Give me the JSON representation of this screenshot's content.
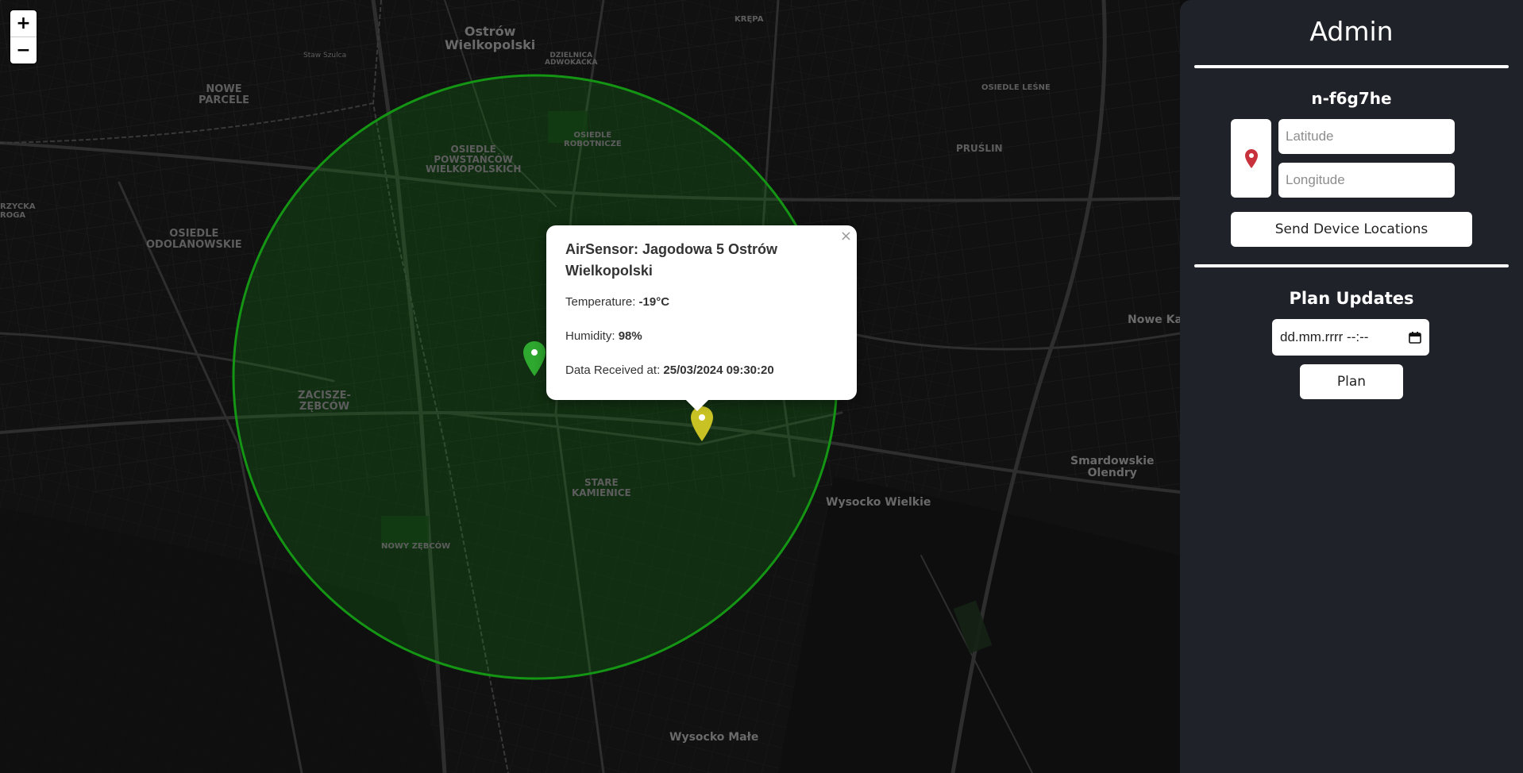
{
  "map": {
    "zoom_in_label": "+",
    "zoom_out_label": "−",
    "labels": {
      "ostrow": "Ostrów\nWielkopolski",
      "krepa": "KRĘPA",
      "stawszulca": "Staw Szulca",
      "dzielnica": "DZIELNICA\nADWOKACKA",
      "nowe_parcele": "NOWE\nPARCELE",
      "osiedle_lesne": "OSIEDLE LEŚNE",
      "robotnicze": "OSIEDLE\nROBOTNICZE",
      "powstancow": "OSIEDLE\nPOWSTAŃCÓW\nWIELKOPOLSKICH",
      "pruslin": "PRUŚLIN",
      "krzycka": "RZYCKA\nROGA",
      "odolanowskie": "OSIEDLE\nODOLANOWSKIE",
      "nowe_ka": "Nowe Ka",
      "zacisze": "ZACISZE-\nZĘBCÓW",
      "smardowskie": "Smardowskie\nOlendry",
      "stare_kamienice": "STARE\nKAMIENICE",
      "wysocko_wielkie": "Wysocko Wielkie",
      "nowy_zebcow": "NOWY ZĘBCÓW",
      "wysocko_male": "Wysocko Małe"
    },
    "circle_color": "#149514",
    "markers": [
      {
        "name": "green-sensor-marker",
        "color": "#2ea82e"
      },
      {
        "name": "yellow-sensor-marker",
        "color": "#c9c225"
      }
    ]
  },
  "popup": {
    "close_label": "×",
    "title": "AirSensor: Jagodowa 5 Ostrów Wielkopolski",
    "temperature_label": "Temperature:",
    "temperature_value": "-19°C",
    "humidity_label": "Humidity:",
    "humidity_value": "98%",
    "received_label": "Data Received at:",
    "received_value": "25/03/2024 09:30:20"
  },
  "panel": {
    "title": "Admin",
    "device_id": "n-f6g7he",
    "latitude_placeholder": "Latitude",
    "longitude_placeholder": "Longitude",
    "send_button": "Send Device Locations",
    "plan_section_title": "Plan Updates",
    "date_placeholder": "dd.mm.rrrr --:--",
    "plan_button": "Plan",
    "location_icon": "map-pin-icon",
    "location_icon_color": "#c8323c",
    "background": "#1f2229"
  }
}
